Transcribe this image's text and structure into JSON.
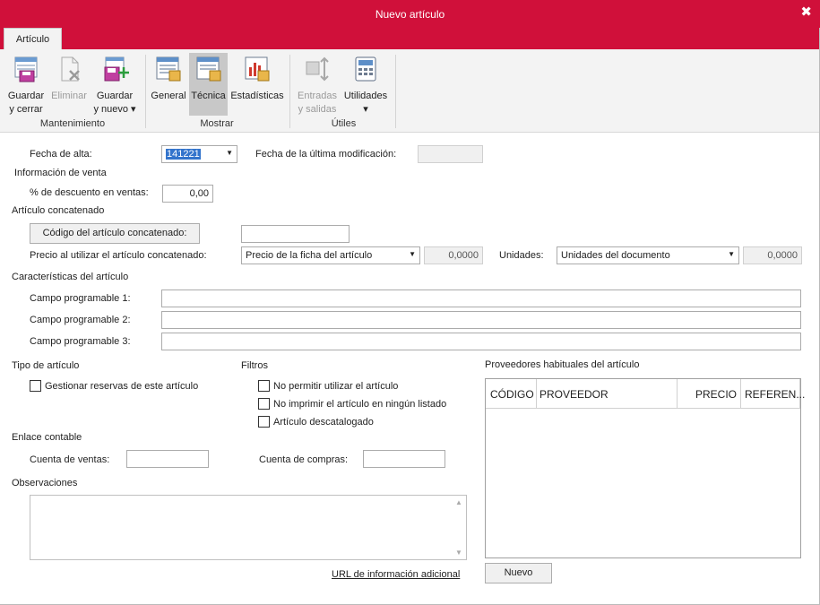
{
  "window": {
    "title": "Nuevo artículo",
    "close_glyph": "✖"
  },
  "tabs": [
    {
      "label": "Artículo",
      "active": true
    }
  ],
  "ribbon": {
    "buttons": [
      {
        "label1": "Guardar",
        "label2": "y cerrar",
        "icon": "save-close-icon"
      },
      {
        "label1": "Eliminar",
        "label2": "",
        "icon": "delete-icon",
        "disabled": true
      },
      {
        "label1": "Guardar",
        "label2": "y nuevo ▾",
        "icon": "save-new-icon"
      },
      {
        "label1": "General",
        "label2": "",
        "icon": "general-view-icon"
      },
      {
        "label1": "Técnica",
        "label2": "",
        "icon": "technical-view-icon",
        "selected": true
      },
      {
        "label1": "Estadísticas",
        "label2": "",
        "icon": "statistics-icon"
      },
      {
        "label1": "Entradas",
        "label2": "y salidas",
        "icon": "in-out-icon",
        "disabled": true
      },
      {
        "label1": "Utilidades",
        "label2": "▾",
        "icon": "calculator-icon"
      }
    ],
    "groups": [
      "Mantenimiento",
      "Mostrar",
      "Útiles"
    ]
  },
  "form": {
    "fecha_alta_label": "Fecha de alta:",
    "fecha_alta_value": "141221",
    "fecha_mod_label": "Fecha de la última modificación:",
    "fecha_mod_value": "",
    "info_venta": "Información de venta",
    "descuento_label": "% de descuento en ventas:",
    "descuento_value": "0,00",
    "concat_section": "Artículo concatenado",
    "concat_button": "Código del artículo concatenado:",
    "concat_value": "",
    "precio_label": "Precio al utilizar el artículo concatenado:",
    "precio_select": "Precio de la ficha del artículo",
    "precio_value": "0,0000",
    "unidades_label": "Unidades:",
    "unidades_select": "Unidades del documento",
    "unidades_value": "0,0000",
    "caracteristicas": "Características del artículo",
    "campo1_label": "Campo programable 1:",
    "campo2_label": "Campo programable 2:",
    "campo3_label": "Campo programable 3:",
    "campo1_value": "",
    "campo2_value": "",
    "campo3_value": "",
    "tipo_section": "Tipo de artículo",
    "reservas_label": "Gestionar reservas de este artículo",
    "filtros_section": "Filtros",
    "filtro1": "No permitir utilizar el artículo",
    "filtro2": "No imprimir el artículo en ningún listado",
    "filtro3": "Artículo descatalogado",
    "enlace_section": "Enlace contable",
    "cuenta_ventas_label": "Cuenta de ventas:",
    "cuenta_compras_label": "Cuenta de compras:",
    "cuenta_ventas_value": "",
    "cuenta_compras_value": "",
    "observaciones": "Observaciones",
    "url_link": "URL de información adicional",
    "proveedores_section": "Proveedores habituales del artículo",
    "grid_headers": [
      "CÓDIGO",
      "PROVEEDOR",
      "PRECIO",
      "REFEREN..."
    ],
    "nuevo_button": "Nuevo"
  }
}
